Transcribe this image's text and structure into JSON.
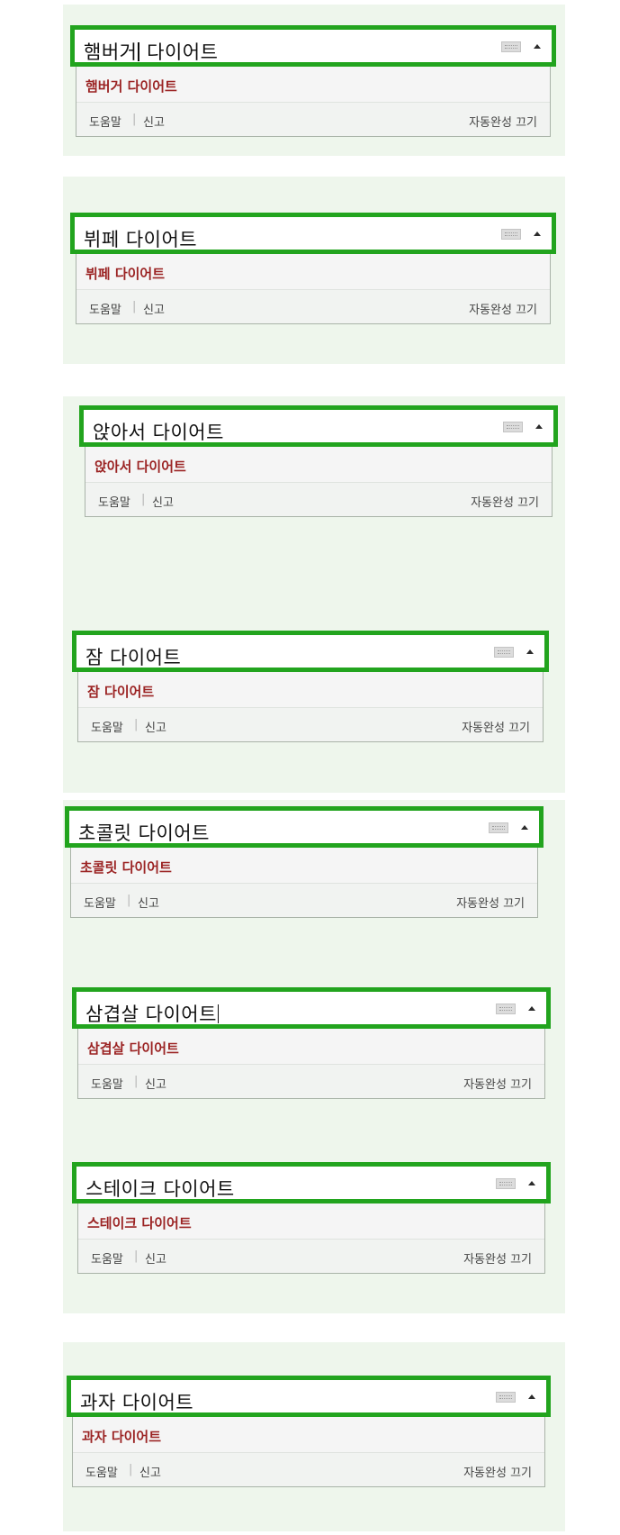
{
  "widgets": [
    {
      "query": "햄버거",
      "query_rest": " 다이어트",
      "suggestion": "햄버거 다이어트",
      "help": "도움말",
      "report": "신고",
      "autocomplete_off": "자동완성 끄기"
    },
    {
      "query": "뷔페 다이어트",
      "query_rest": "",
      "suggestion": "뷔페 다이어트",
      "help": "도움말",
      "report": "신고",
      "autocomplete_off": "자동완성 끄기"
    },
    {
      "query": "앉아서 다이어트",
      "query_rest": "",
      "suggestion": "앉아서 다이어트",
      "help": "도움말",
      "report": "신고",
      "autocomplete_off": "자동완성 끄기"
    },
    {
      "query": "잠 다이어트",
      "query_rest": "",
      "suggestion": "잠 다이어트",
      "help": "도움말",
      "report": "신고",
      "autocomplete_off": "자동완성 끄기"
    },
    {
      "query": "초콜릿 다이어트",
      "query_rest": "",
      "suggestion": "초콜릿 다이어트",
      "help": "도움말",
      "report": "신고",
      "autocomplete_off": "자동완성 끄기"
    },
    {
      "query": "삼겹살 다이어트",
      "query_rest": "",
      "suggestion": "삼겹살 다이어트",
      "help": "도움말",
      "report": "신고",
      "autocomplete_off": "자동완성 끄기"
    },
    {
      "query": "스테이크 다이어트",
      "query_rest": "",
      "suggestion": "스테이크 다이어트",
      "help": "도움말",
      "report": "신고",
      "autocomplete_off": "자동완성 끄기"
    },
    {
      "query": "과자 다이어트",
      "query_rest": "",
      "suggestion": "과자 다이어트",
      "help": "도움말",
      "report": "신고",
      "autocomplete_off": "자동완성 끄기"
    }
  ],
  "separator": "|",
  "icons": {
    "keyboard": "keyboard-icon",
    "collapse": "chevron-up-icon"
  },
  "colors": {
    "border": "#22a41e",
    "suggestion_text": "#9b2323",
    "panel_bg": "#eef6ec"
  }
}
